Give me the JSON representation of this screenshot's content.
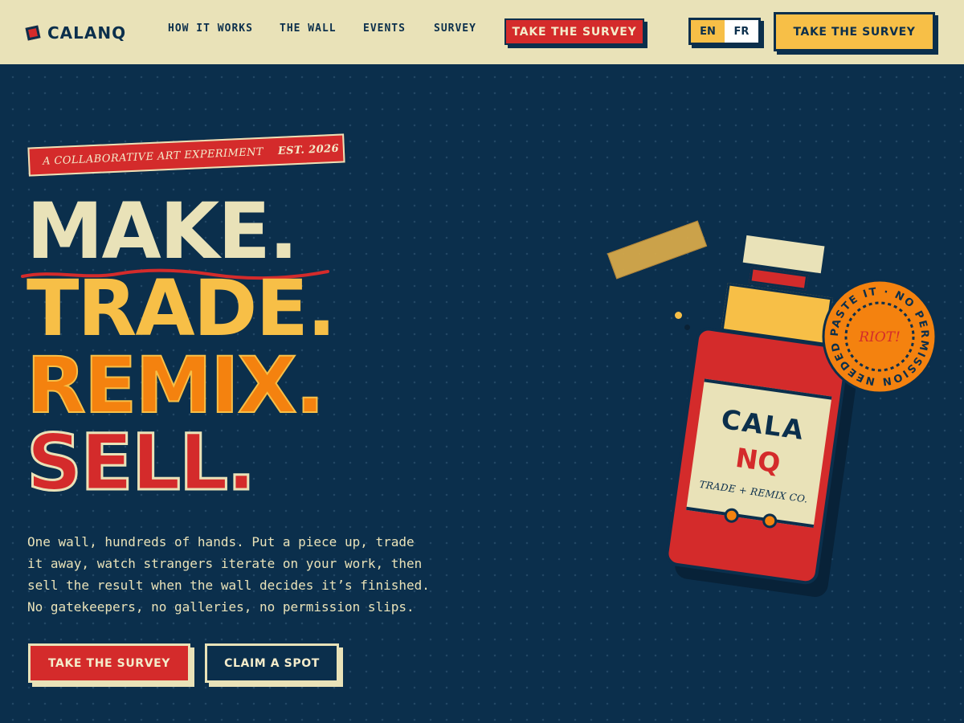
{
  "brand": {
    "name": "CALANQ"
  },
  "nav": {
    "links": [
      "HOW IT WORKS",
      "THE WALL",
      "EVENTS",
      "SURVEY"
    ],
    "cta_label": "TAKE THE SURVEY"
  },
  "language": {
    "options": [
      "EN",
      "FR"
    ],
    "selected": "EN"
  },
  "header_cta": {
    "label": "TAKE THE SURVEY"
  },
  "hero": {
    "eyebrow": "A COLLABORATIVE ART EXPERIMENT",
    "eyebrow_est": "EST. 2026",
    "headline": [
      "MAKE.",
      "TRADE.",
      "REMIX.",
      "SELL."
    ],
    "lede": "One wall, hundreds of hands. Put a piece up, trade it away, watch strangers iterate on your work, then sell the result when the wall decides it’s finished. No gatekeepers, no galleries, no permission slips.",
    "primary_cta": "TAKE THE SURVEY",
    "secondary_cta": "CLAIM A SPOT"
  },
  "illustration": {
    "label_line1": "CALA",
    "label_line2": "NQ",
    "label_sub": "TRADE + REMIX CO.",
    "stamp_ring_text": "PASTE IT · NO PERMISSION NEEDED",
    "stamp_center": "RIOT!"
  },
  "colors": {
    "navy": "#0b2f4c",
    "cream": "#e9e2b8",
    "red": "#d42b2b",
    "yellow": "#f7bf47",
    "orange": "#f4820f"
  }
}
